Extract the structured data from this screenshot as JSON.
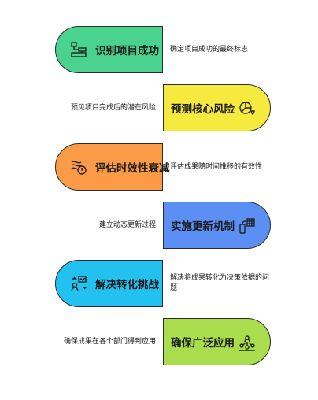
{
  "steps": [
    {
      "label": "识别项目成功",
      "description": "确定项目成功的最终标志",
      "icon": "workflow-icon",
      "color": "#4ad38f"
    },
    {
      "label": "预测核心风险",
      "description": "预见项目完成后的潜在风险",
      "icon": "pie-chart-bulb-icon",
      "color": "#f6ea3f"
    },
    {
      "label": "评估时效性衰减",
      "description": "评估成果随时间推移的有效性",
      "icon": "decay-clock-icon",
      "color": "#fb9b48"
    },
    {
      "label": "实施更新机制",
      "description": "建立动态更新过程",
      "icon": "phone-calculator-icon",
      "color": "#5b8ff3"
    },
    {
      "label": "解决转化挑战",
      "description": "解决将成果转化为决策依据的问题",
      "icon": "presenter-icon",
      "color": "#22c1f0"
    },
    {
      "label": "确保广泛应用",
      "description": "确保成果在各个部门得到应用",
      "icon": "network-people-icon",
      "color": "#a9dd4d"
    }
  ]
}
